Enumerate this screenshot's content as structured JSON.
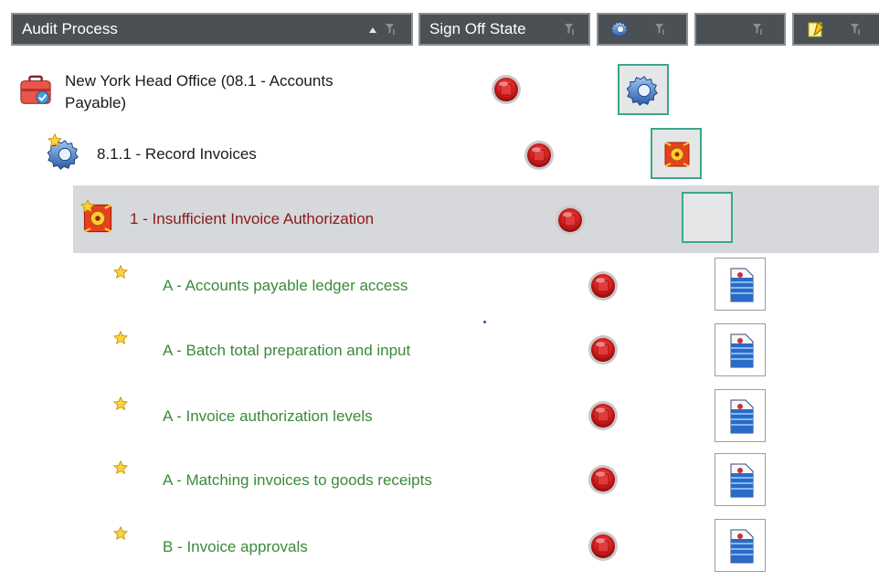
{
  "columns": {
    "audit_process": "Audit Process",
    "sign_off_state": "Sign Off State",
    "icon_col1": "gear-icon",
    "icon_col2": "lock-icon",
    "icon_col3": "notepad-icon"
  },
  "rows": [
    {
      "label_line1": "New York Head Office (08.1 - Accounts",
      "label_line2": "Payable)",
      "icon": "briefcase-icon",
      "status": "stop-icon",
      "action": "gear-icon",
      "color": "#1a1a1a"
    },
    {
      "label": "8.1.1 - Record Invoices",
      "icon": "gear-star-icon",
      "status": "stop-icon",
      "action": "risk-icon",
      "color": "#1a1a1a"
    },
    {
      "label": "1 - Insufficient Invoice Authorization",
      "icon": "risk-icon",
      "status": "stop-icon",
      "action": "lock-icon",
      "color": "#8b1a1a"
    },
    {
      "label": "A - Accounts payable ledger access",
      "icon": "red-lock-star-icon",
      "status": "stop-icon",
      "action": "document-icon",
      "color": "#3a8a3a"
    },
    {
      "label": "A - Batch total preparation and input",
      "icon": "red-lock-star-icon",
      "status": "stop-icon",
      "action": "document-icon",
      "color": "#3a8a3a"
    },
    {
      "label": "A - Invoice authorization levels",
      "icon": "yellow-lock-star-icon",
      "status": "stop-icon",
      "action": "document-icon",
      "color": "#3a8a3a"
    },
    {
      "label": "A - Matching invoices to goods receipts",
      "icon": "red-lock-star-icon",
      "status": "stop-icon",
      "action": "document-icon",
      "color": "#3a8a3a"
    },
    {
      "label": "B - Invoice approvals",
      "icon": "yellow-lock-star-icon",
      "status": "stop-icon",
      "action": "document-icon",
      "color": "#3a8a3a"
    }
  ],
  "colors": {
    "header_bg": "#4a5053",
    "selected_bg": "#d6d8db",
    "green_text": "#3a8a3a",
    "red_text": "#8b1a1a",
    "teal_border": "#3aa88a"
  }
}
